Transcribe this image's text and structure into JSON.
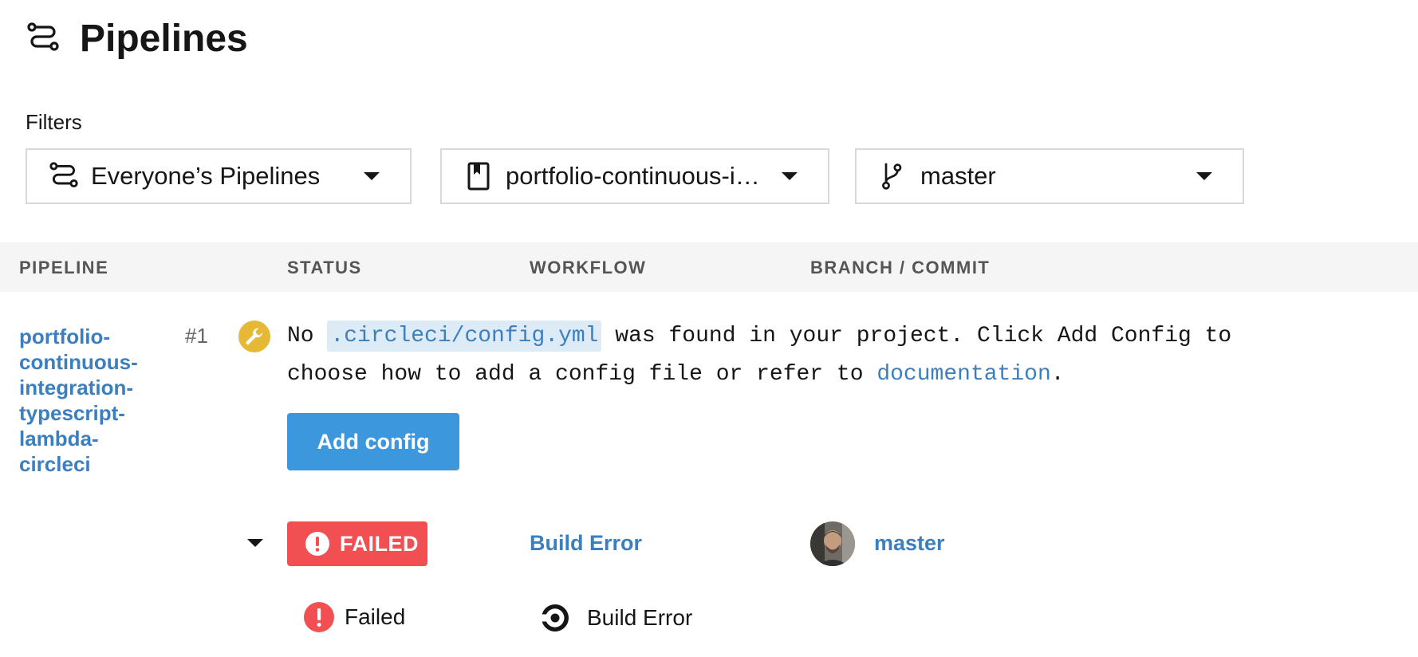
{
  "page": {
    "title": "Pipelines",
    "title_icon": "pipelines-icon"
  },
  "filters": {
    "label": "Filters",
    "pipelines": {
      "value": "Everyone’s Pipelines",
      "icon": "pipelines-icon"
    },
    "project": {
      "value": "portfolio-continuous-i…",
      "icon": "bookmark-icon"
    },
    "branch": {
      "value": "master",
      "icon": "git-branch-icon"
    }
  },
  "table": {
    "headers": [
      "PIPELINE",
      "STATUS",
      "WORKFLOW",
      "BRANCH / COMMIT"
    ]
  },
  "pipeline": {
    "name": "portfolio-continuous-integration-typescript-lambda-circleci",
    "name_lines": [
      "portfolio-",
      "continuous-",
      "integration-",
      "typescript-",
      "lambda-",
      "circleci"
    ],
    "number": "#1",
    "badge_icon": "wrench-icon",
    "message": {
      "prefix": "No ",
      "config_path": ".circleci/config.yml",
      "middle": " was found in your project. Click Add Config to choose how to add a config file or refer to ",
      "link": "documentation",
      "suffix": "."
    },
    "add_config_label": "Add config",
    "status": "FAILED",
    "workflow": "Build Error",
    "branch": "master"
  },
  "job": {
    "status": "Failed",
    "name": "Build Error"
  },
  "colors": {
    "link": "#3b7fbf",
    "button": "#3d97dc",
    "failed": "#f24f53",
    "warning": "#e5b935",
    "header_bg": "#f5f5f5"
  }
}
